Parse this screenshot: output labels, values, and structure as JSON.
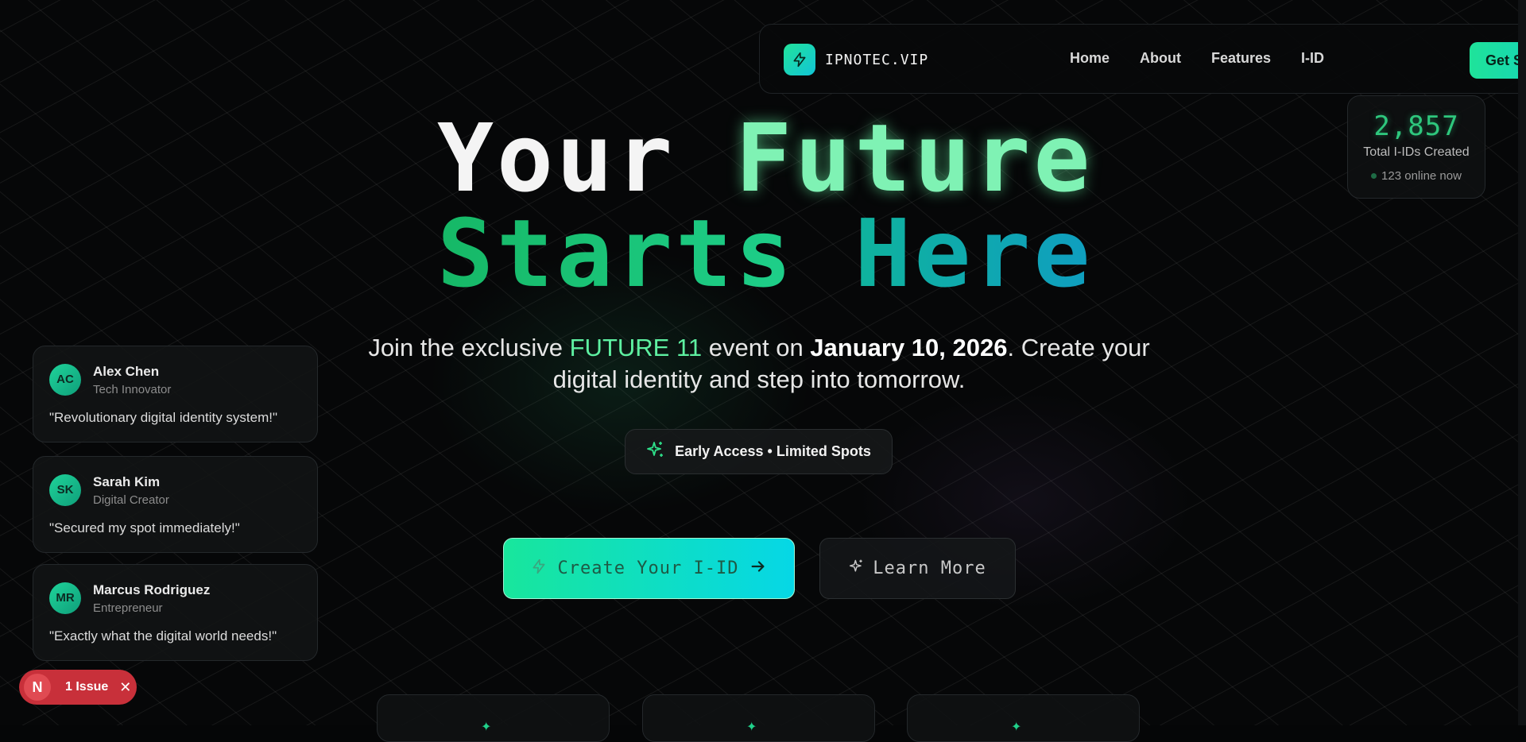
{
  "nav": {
    "brand": "IPNOTEC.VIP",
    "links": [
      "Home",
      "About",
      "Features",
      "I-ID"
    ],
    "cta": "Get S"
  },
  "stats": {
    "count": "2,857",
    "label": "Total I-IDs Created",
    "online": "123 online now"
  },
  "hero": {
    "line1_a": "Your",
    "line1_b": "Future",
    "line2_a": "Starts",
    "line2_b": "Here",
    "sub_1": "Join the exclusive ",
    "sub_highlight": "FUTURE 11",
    "sub_2": " event on ",
    "sub_date": "January 10, 2026",
    "sub_3": ". Create your digital identity and step into tomorrow.",
    "pill": "Early Access • Limited Spots",
    "primary_button": "Create Your I-ID",
    "secondary_button": "Learn More"
  },
  "testimonials": [
    {
      "initials": "AC",
      "name": "Alex Chen",
      "role": "Tech Innovator",
      "quote": "\"Revolutionary digital identity system!\""
    },
    {
      "initials": "SK",
      "name": "Sarah Kim",
      "role": "Digital Creator",
      "quote": "\"Secured my spot immediately!\""
    },
    {
      "initials": "MR",
      "name": "Marcus Rodriguez",
      "role": "Entrepreneur",
      "quote": "\"Exactly what the digital world needs!\""
    }
  ],
  "issue_badge": {
    "letter": "N",
    "text": "1 Issue"
  },
  "colors": {
    "accent": "#1fe39a",
    "accent2": "#06d7e6",
    "issue": "#c8303a"
  }
}
